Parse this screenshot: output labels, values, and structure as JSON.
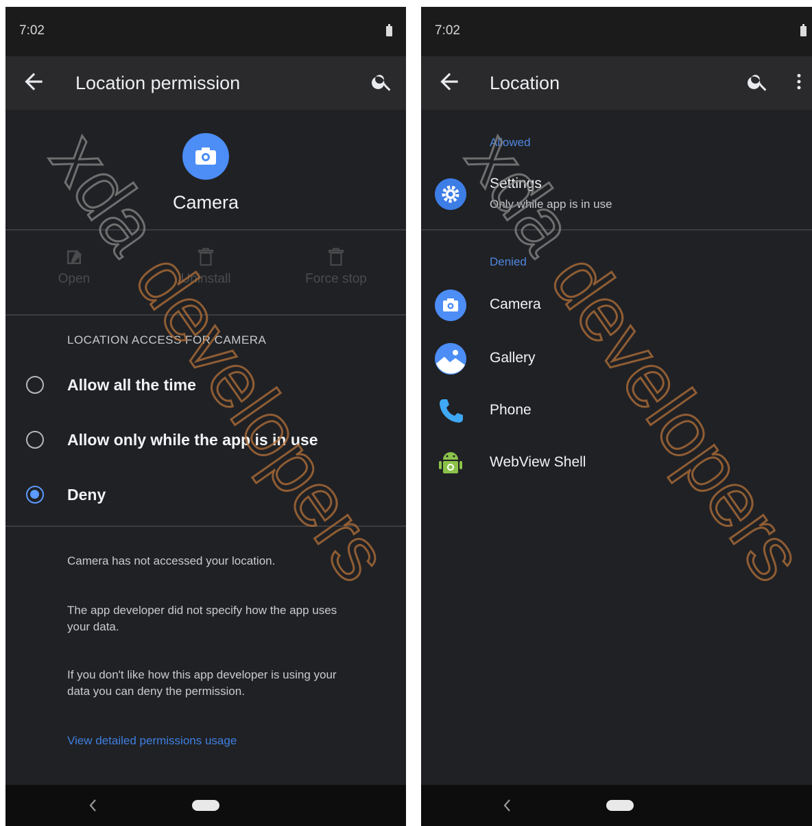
{
  "left": {
    "status_time": "7:02",
    "toolbar_title": "Location permission",
    "app_name": "Camera",
    "actions": [
      "Open",
      "Uninstall",
      "Force stop"
    ],
    "section_header": "LOCATION ACCESS FOR CAMERA",
    "options": [
      {
        "label": "Allow all the time",
        "selected": false
      },
      {
        "label": "Allow only while the app is in use",
        "selected": false
      },
      {
        "label": "Deny",
        "selected": true
      }
    ],
    "info": [
      "Camera has not accessed your location.",
      "The app developer did not specify how the app uses your data.",
      "If you don't like how this app developer is using your data you can deny the permission."
    ],
    "link": "View detailed permissions usage"
  },
  "right": {
    "status_time": "7:02",
    "toolbar_title": "Location",
    "allowed_header": "Allowed",
    "denied_header": "Denied",
    "allowed_items": [
      {
        "title": "Settings",
        "subtitle": "Only while app is in use",
        "icon": "settings-gear-icon"
      }
    ],
    "denied_items": [
      {
        "title": "Camera",
        "icon": "camera-icon"
      },
      {
        "title": "Gallery",
        "icon": "gallery-icon"
      },
      {
        "title": "Phone",
        "icon": "phone-icon"
      },
      {
        "title": "WebView Shell",
        "icon": "android-icon"
      }
    ]
  },
  "watermark": "xdadevelopers",
  "colors": {
    "background": "#202124",
    "accent": "#5c9aff",
    "link": "#3f7fe0",
    "watermark": "#b5713a"
  }
}
